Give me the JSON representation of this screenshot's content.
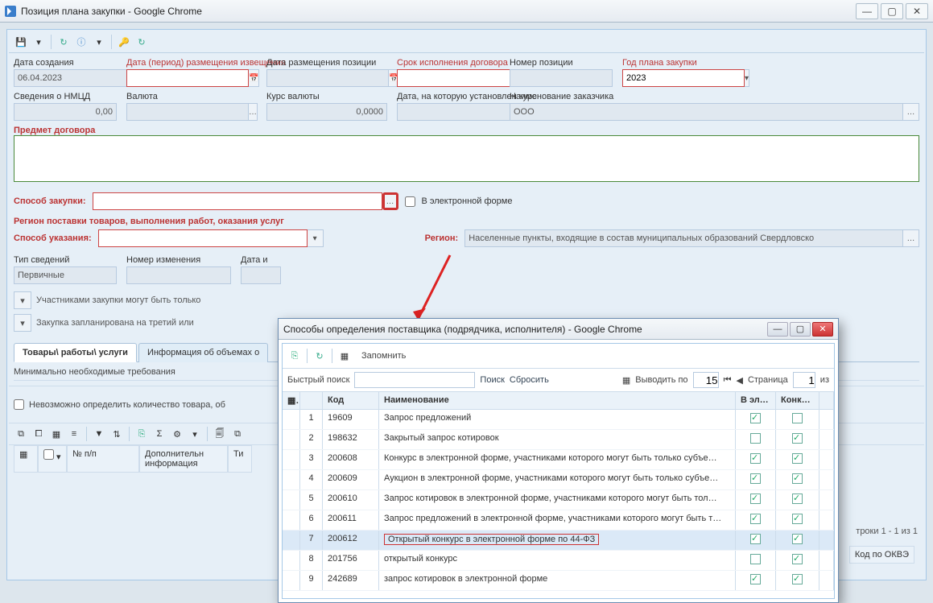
{
  "main_window": {
    "title": "Позиция плана закупки - Google Chrome"
  },
  "fields": {
    "sozdaniya": {
      "label": "Дата создания",
      "value": "06.04.2023"
    },
    "period": {
      "label": "Дата (период) размещения извещения"
    },
    "razm": {
      "label": "Дата размещения позиции"
    },
    "srok": {
      "label": "Срок исполнения договора"
    },
    "nomer": {
      "label": "Номер позиции"
    },
    "god": {
      "label": "Год плана закупки",
      "value": "2023"
    },
    "nmcd": {
      "label": "Сведения о НМЦД",
      "value": "0,00"
    },
    "valuta": {
      "label": "Валюта"
    },
    "kurs": {
      "label": "Курс валюты",
      "value": "0,0000"
    },
    "kursdate": {
      "label": "Дата, на которую установлен курс"
    },
    "zakazchik": {
      "label": "Наименование заказчика",
      "value": "ООО"
    }
  },
  "predmet": {
    "label": "Предмет договора"
  },
  "sposob": {
    "label": "Способ закупки:",
    "checkbox": "В электронной форме"
  },
  "region": {
    "title": "Регион поставки товаров, выполнения работ, оказания услуг",
    "sposob_uk": "Способ указания:",
    "reglbl": "Регион:",
    "regval": "Населенные пункты, входящие в состав муниципальных образований Свердловско"
  },
  "lower": {
    "tip": {
      "label": "Тип сведений",
      "value": "Первичные"
    },
    "nomer_izm": "Номер изменения",
    "data_i": "Дата и",
    "chk1": "Участниками закупки могут быть только",
    "chk2": "Закупка запланирована на третий или"
  },
  "tabs": {
    "t1": "Товары\\ работы\\ услуги",
    "t2": "Информация об объемах о"
  },
  "min_req": "Минимально необходимые требования",
  "no_qty": "Невозможно определить количество товара, об",
  "grid": {
    "h_chk": "",
    "h_np": "№ п/п",
    "h_dop": "Дополнительн информация",
    "h_tip": "Ти",
    "h_kod": "Код по ОКВЭ",
    "rows_info": "троки 1 - 1 из 1"
  },
  "popup": {
    "title": "Способы определения поставщика (подрядчика, исполнителя) - Google Chrome"
  },
  "ptoolbar": {
    "zap": "Запомнить"
  },
  "psearch": {
    "quick": "Быстрый поиск",
    "search": "Поиск",
    "reset": "Сбросить",
    "vyvod": "Выводить по",
    "perpage": "15",
    "stranica": "Страница",
    "page": "1",
    "iz": "из"
  },
  "ptable": {
    "h_kod": "Код",
    "h_name": "Наименование",
    "h_ef": "В элек… форме",
    "h_konk": "Конк… способ заку…",
    "rows": [
      {
        "n": "1",
        "kod": "19609",
        "name": "Запрос предложений",
        "ef": true,
        "konk": false
      },
      {
        "n": "2",
        "kod": "198632",
        "name": "Закрытый запрос котировок",
        "ef": false,
        "konk": true
      },
      {
        "n": "3",
        "kod": "200608",
        "name": "Конкурс в электронной форме, участниками которого могут быть только субъе…",
        "ef": true,
        "konk": true
      },
      {
        "n": "4",
        "kod": "200609",
        "name": "Аукцион в электронной форме, участниками которого могут быть только субъе…",
        "ef": true,
        "konk": true
      },
      {
        "n": "5",
        "kod": "200610",
        "name": "Запрос котировок в электронной форме, участниками которого могут быть тол…",
        "ef": true,
        "konk": true
      },
      {
        "n": "6",
        "kod": "200611",
        "name": "Запрос предложений в электронной форме, участниками которого могут быть т…",
        "ef": true,
        "konk": true
      },
      {
        "n": "7",
        "kod": "200612",
        "name": "Открытый конкурс в электронной форме по 44-ФЗ",
        "ef": true,
        "konk": true
      },
      {
        "n": "8",
        "kod": "201756",
        "name": "открытый конкурс",
        "ef": false,
        "konk": true
      },
      {
        "n": "9",
        "kod": "242689",
        "name": "запрос котировок в электронной форме",
        "ef": true,
        "konk": true
      }
    ]
  }
}
